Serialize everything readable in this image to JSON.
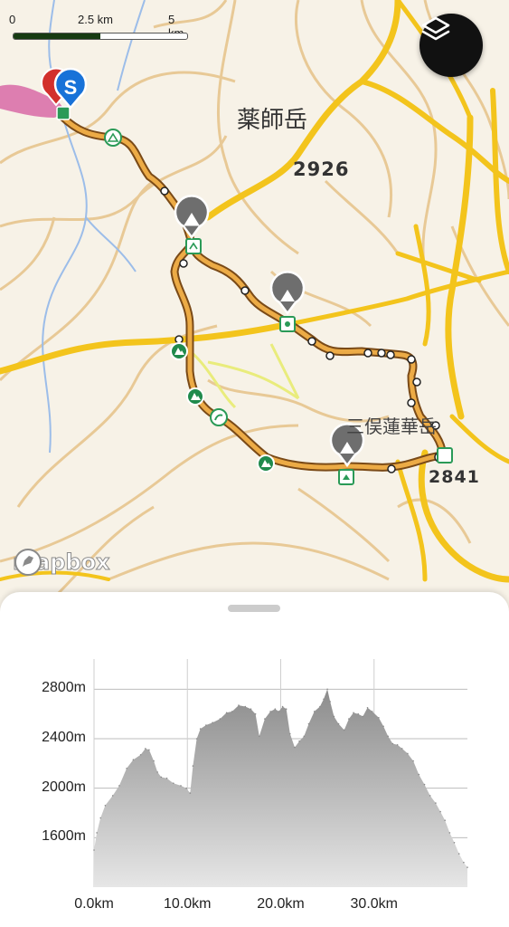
{
  "map": {
    "scale": {
      "labels": [
        "0",
        "2.5 km",
        "5 km"
      ]
    },
    "peak_labels": [
      "薬師岳",
      "2926",
      "三俣蓮華岳",
      "2841"
    ],
    "attribution": "mapbox",
    "start_marker": "S",
    "layers_icon": "layers-icon",
    "colors": {
      "route": "#e8a33a",
      "road": "#f2c61a",
      "contour": "#e7c48c",
      "stream": "#8fb3e8"
    }
  },
  "profile": {
    "y_labels": [
      "2800m",
      "2400m",
      "2000m",
      "1600m"
    ],
    "x_labels": [
      "0.0km",
      "10.0km",
      "20.0km",
      "30.0km"
    ]
  },
  "chart_data": {
    "type": "area",
    "title": "",
    "xlabel": "",
    "ylabel": "",
    "xlim": [
      0,
      40
    ],
    "ylim": [
      1200,
      3000
    ],
    "x": [
      0,
      0.3,
      0.7,
      1.2,
      2,
      2.7,
      3.5,
      4.2,
      5,
      5.5,
      5.9,
      6.4,
      6.8,
      7.2,
      7.8,
      8.5,
      9.3,
      9.9,
      10.3,
      10.6,
      11,
      11.4,
      12,
      12.7,
      13.5,
      14.2,
      14.8,
      15.5,
      16.2,
      16.8,
      17.3,
      17.7,
      18.3,
      18.9,
      19.4,
      19.8,
      20.2,
      20.6,
      21,
      21.5,
      22,
      22.5,
      23,
      23.6,
      24.2,
      24.6,
      25,
      25.3,
      25.7,
      26.2,
      26.8,
      27.3,
      27.8,
      28.3,
      28.8,
      29.3,
      29.8,
      30.5,
      31,
      31.5,
      32,
      32.5,
      33,
      33.6,
      34.2,
      34.8,
      35.4,
      36,
      36.6,
      37.1,
      37.6,
      38.1,
      38.6,
      39.1,
      39.6,
      40
    ],
    "y": [
      1500,
      1640,
      1760,
      1860,
      1940,
      2020,
      2160,
      2230,
      2270,
      2320,
      2310,
      2220,
      2130,
      2090,
      2080,
      2040,
      2020,
      2000,
      1960,
      2180,
      2400,
      2480,
      2510,
      2530,
      2560,
      2610,
      2620,
      2670,
      2660,
      2640,
      2600,
      2420,
      2560,
      2620,
      2640,
      2620,
      2660,
      2640,
      2440,
      2330,
      2380,
      2420,
      2520,
      2620,
      2660,
      2720,
      2800,
      2700,
      2580,
      2520,
      2470,
      2560,
      2610,
      2600,
      2580,
      2650,
      2620,
      2570,
      2500,
      2420,
      2360,
      2350,
      2320,
      2280,
      2220,
      2110,
      2030,
      1940,
      1880,
      1810,
      1740,
      1640,
      1560,
      1470,
      1400,
      1360
    ]
  }
}
